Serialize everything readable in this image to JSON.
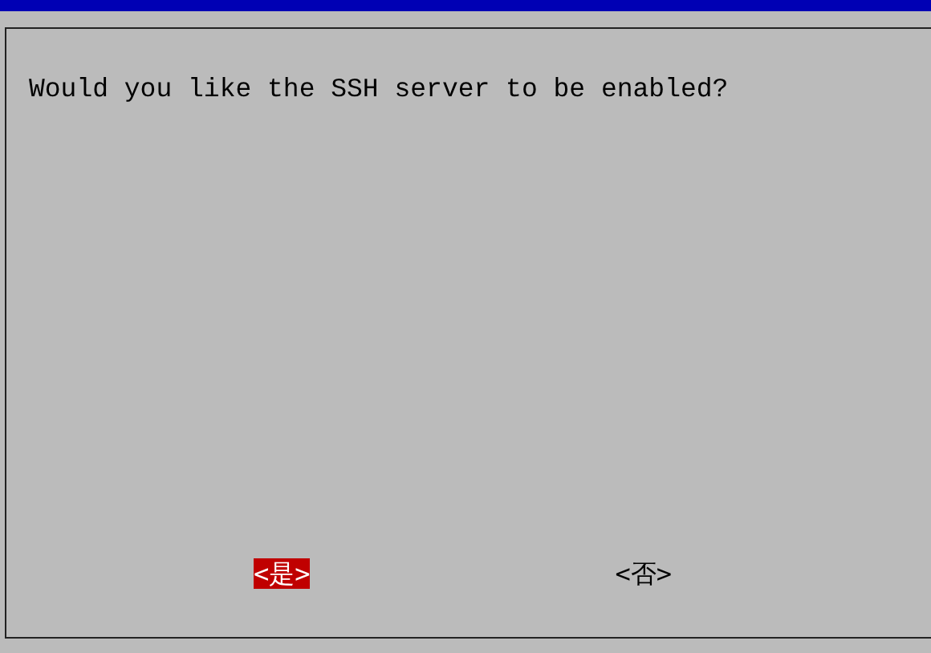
{
  "dialog": {
    "message": "Would you like the SSH server to be enabled?"
  },
  "buttons": [
    {
      "label": "<是>",
      "selected": true
    },
    {
      "label": "<否>",
      "selected": false
    }
  ]
}
